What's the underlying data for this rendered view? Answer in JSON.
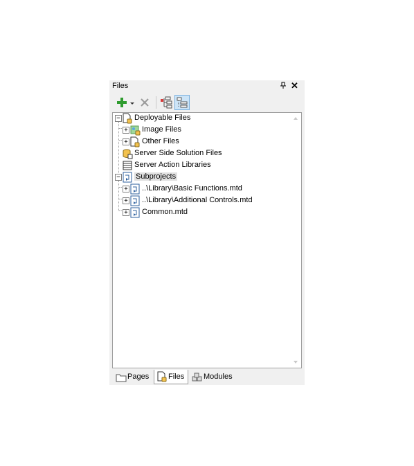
{
  "panel": {
    "title": "Files",
    "pin_icon": "pin-icon",
    "close_icon": "close-icon"
  },
  "toolbar": {
    "add_icon": "add-icon",
    "dropdown_icon": "chevron-down-icon",
    "delete_icon": "delete-icon",
    "tree_view_icon": "tree-view-icon",
    "list_view_icon": "list-view-icon"
  },
  "tree": {
    "deployable_files": "Deployable Files",
    "image_files": "Image Files",
    "other_files": "Other Files",
    "server_side_solution_files": "Server Side Solution Files",
    "server_action_libraries": "Server Action Libraries",
    "subprojects": "Subprojects",
    "sub_basic": "..\\Library\\Basic Functions.mtd",
    "sub_additional": "..\\Library\\Additional Controls.mtd",
    "sub_common": "Common.mtd"
  },
  "tabs": {
    "pages": "Pages",
    "files": "Files",
    "modules": "Modules",
    "active": "Files"
  },
  "colors": {
    "accent_green": "#2e9b2e",
    "selection": "#e0e0e0",
    "border": "#a0a0a0"
  }
}
